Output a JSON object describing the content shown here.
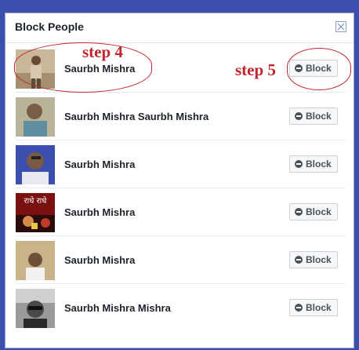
{
  "dialog": {
    "title": "Block People",
    "close_icon": "close-icon"
  },
  "rows": [
    {
      "name": "Saurbh Mishra",
      "button_label": "Block",
      "avatar": "profile-photo"
    },
    {
      "name": "Saurbh Mishra Saurbh Mishra",
      "button_label": "Block",
      "avatar": "profile-photo"
    },
    {
      "name": "Saurbh Mishra",
      "button_label": "Block",
      "avatar": "profile-photo"
    },
    {
      "name": "Saurbh Mishra",
      "button_label": "Block",
      "avatar": "profile-photo",
      "avatar_text": "राधे राधे"
    },
    {
      "name": "Saurbh Mishra",
      "button_label": "Block",
      "avatar": "profile-photo"
    },
    {
      "name": "Saurbh Mishra Mishra",
      "button_label": "Block",
      "avatar": "profile-photo"
    }
  ],
  "annotations": {
    "step4": "step 4",
    "step5": "step 5"
  },
  "colors": {
    "background": "#3b4fae",
    "annotation": "#c0272d",
    "button_bg": "#f6f7f9"
  }
}
